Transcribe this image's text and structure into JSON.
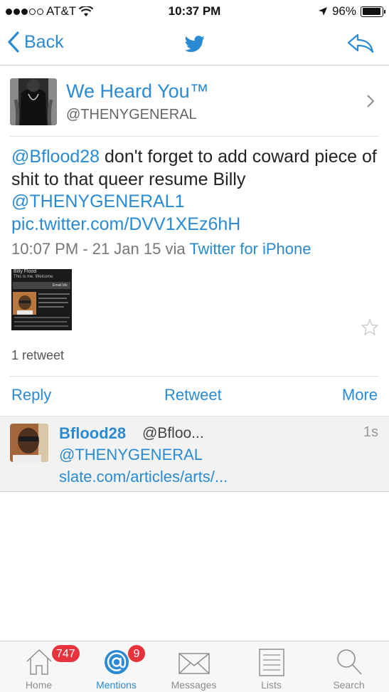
{
  "status_bar": {
    "carrier": "AT&T",
    "time": "10:37 PM",
    "battery": "96%",
    "battery_level": 0.96,
    "signal_bars": 3
  },
  "nav": {
    "back_label": "Back",
    "logo_icon": "twitter-bird-icon",
    "reply_icon": "reply-icon",
    "accent_color": "#2a8ad3"
  },
  "tweet": {
    "author": {
      "display_name": "We Heard You™",
      "handle": "@THENYGENERAL"
    },
    "text": {
      "mention_1": "@Bflood28",
      "body": " don't forget to add coward piece of shit to that queer resume Billy ",
      "mention_2": "@THENYGENERAL1",
      "link": "pic.twitter.com/DVV1XEz6hH"
    },
    "timestamp": "10:07 PM - 21 Jan 15 via ",
    "source": "Twitter for iPhone",
    "media_preview": {
      "title": "Billy Flood",
      "subtitle": "This is me. Welcome",
      "button": "Email Me"
    },
    "retweet_count": "1 retweet"
  },
  "actions": {
    "reply": "Reply",
    "retweet": "Retweet",
    "more": "More"
  },
  "reply": {
    "name": "Bflood28",
    "handle": "@Bfloo...",
    "time": "1s",
    "mention": "@THENYGENERAL",
    "link": "slate.com/articles/arts/..."
  },
  "tabs": [
    {
      "label": "Home",
      "icon": "home-icon",
      "badge": "747",
      "active": false
    },
    {
      "label": "Mentions",
      "icon": "at-sign-icon",
      "badge": "9",
      "active": true
    },
    {
      "label": "Messages",
      "icon": "envelope-icon",
      "badge": "",
      "active": false
    },
    {
      "label": "Lists",
      "icon": "list-icon",
      "badge": "",
      "active": false
    },
    {
      "label": "Search",
      "icon": "search-icon",
      "badge": "",
      "active": false
    }
  ]
}
